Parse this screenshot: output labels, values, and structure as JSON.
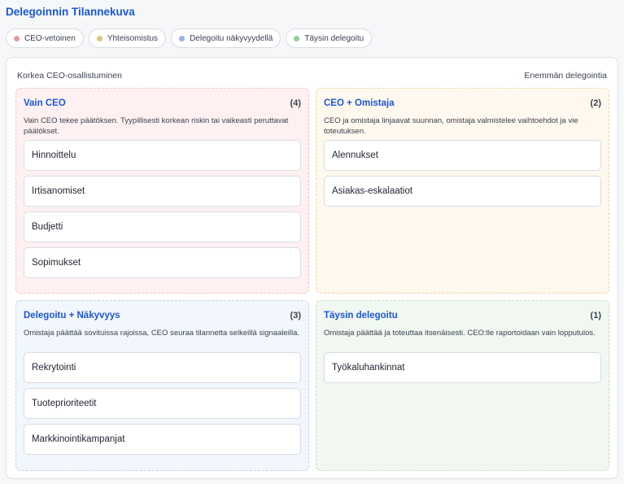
{
  "title": "Delegoinnin Tilannekuva",
  "legend": [
    {
      "label": "CEO-vetoinen",
      "color": "#e79d9d"
    },
    {
      "label": "Yhteisomistus",
      "color": "#e3c27a"
    },
    {
      "label": "Delegoitu näkyvyydellä",
      "color": "#97b4ec"
    },
    {
      "label": "Täysin delegoitu",
      "color": "#8fcf98"
    }
  ],
  "axis": {
    "top_left": "Korkea CEO-osallistuminen",
    "top_right": "Enemmän delegointia"
  },
  "quadrants": [
    {
      "title": "Vain CEO",
      "count": "(4)",
      "description": "Vain CEO tekee päätöksen. Tyypillisesti korkean riskin tai vaikeasti peruttavat päätökset.",
      "items": [
        "Hinnoittelu",
        "Irtisanomiset",
        "Budjetti",
        "Sopimukset"
      ]
    },
    {
      "title": "CEO + Omistaja",
      "count": "(2)",
      "description": "CEO ja omistaja linjaavat suunnan, omistaja valmistelee vaihtoehdot ja vie toteutuksen.",
      "items": [
        "Alennukset",
        "Asiakas-eskalaatiot"
      ]
    },
    {
      "title": "Delegoitu + Näkyvyys",
      "count": "(3)",
      "description": "Omistaja päättää sovituissa rajoissa, CEO seuraa tilannetta selkeillä signaaleilla.",
      "items": [
        "Rekrytointi",
        "Tuoteprioriteetit",
        "Markkinointikampanjat"
      ]
    },
    {
      "title": "Täysin delegoitu",
      "count": "(1)",
      "description": "Omistaja päättää ja toteuttaa itsenäisesti. CEO:lle raportoidaan vain lopputulos.",
      "items": [
        "Työkaluhankinnat"
      ]
    }
  ]
}
